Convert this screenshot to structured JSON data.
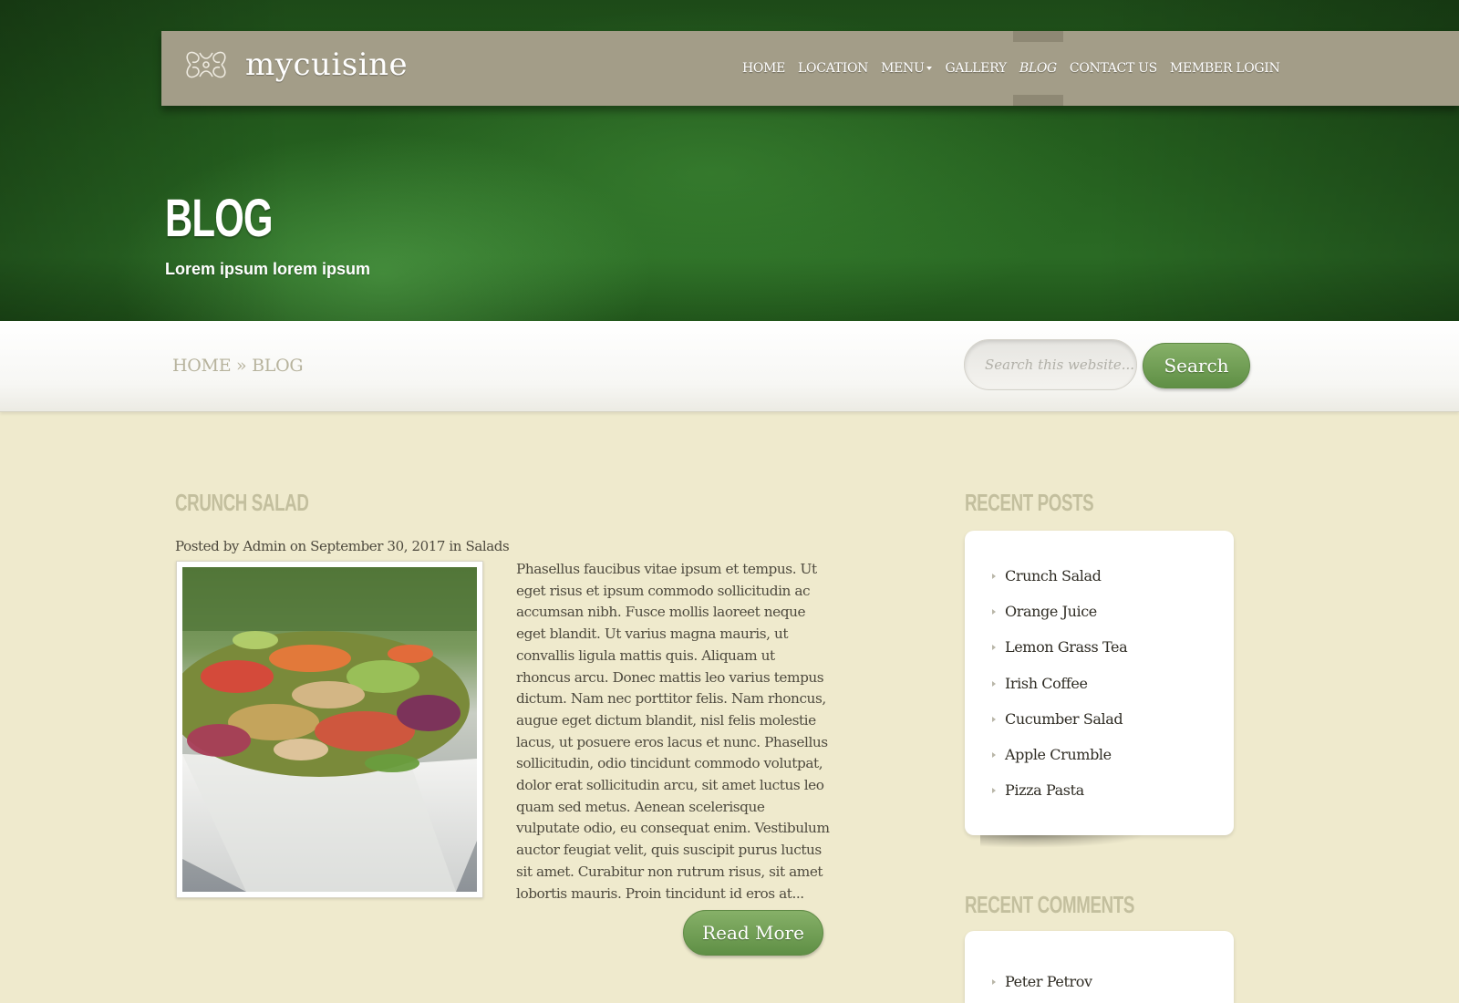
{
  "brand": {
    "name": "mycuisine",
    "logo_icon": "ornament-logo-icon"
  },
  "nav": {
    "items": [
      {
        "label": "HOME"
      },
      {
        "label": "LOCATION"
      },
      {
        "label": "MENU"
      },
      {
        "label": "GALLERY"
      },
      {
        "label": "BLOG"
      },
      {
        "label": "CONTACT US"
      },
      {
        "label": "MEMBER LOGIN"
      }
    ],
    "active": "BLOG",
    "dropdown_icon": "caret-down-icon"
  },
  "hero": {
    "title": "BLOG",
    "subtitle": "Lorem ipsum lorem ipsum"
  },
  "breadcrumb": {
    "home": "HOME",
    "separator": "»",
    "current": "BLOG"
  },
  "search": {
    "placeholder": "Search this website...",
    "button_label": "Search"
  },
  "post": {
    "title": "CRUNCH SALAD",
    "meta": {
      "prefix": "Posted by",
      "author": "Admin",
      "on": "on",
      "date": "September 30, 2017",
      "in": "in",
      "category": "Salads"
    },
    "excerpt": "Phasellus faucibus vitae ipsum et tempus. Ut eget risus et ipsum commodo sollicitudin ac accumsan nibh. Fusce mollis laoreet neque eget blandit. Ut varius magna mauris, ut convallis ligula mattis quis. Aliquam ut rhoncus arcu. Donec mattis leo varius tempus dictum. Nam nec porttitor felis. Nam rhoncus, augue eget dictum blandit, nisl felis molestie lacus, ut posuere eros lacus et nunc. Phasellus sollicitudin, odio tincidunt commodo volutpat, dolor erat sollicitudin arcu, sit amet luctus leo quam sed metus. Aenean scelerisque vulputate odio, eu consequat enim. Vestibulum auctor feugiat velit, quis suscipit purus luctus sit amet. Curabitur non rutrum risus, sit amet lobortis mauris. Proin tincidunt id eros at...",
    "read_more": "Read More",
    "image_icon": "salad-bowl-photo"
  },
  "sidebar": {
    "recent_posts": {
      "title": "RECENT POSTS",
      "items": [
        "Crunch Salad",
        "Orange Juice",
        "Lemon Grass Tea",
        "Irish Coffee",
        "Cucumber Salad",
        "Apple Crumble",
        "Pizza Pasta"
      ]
    },
    "recent_comments": {
      "title": "RECENT COMMENTS",
      "items": [
        "Peter Petrov"
      ]
    }
  },
  "colors": {
    "hero_green": "#245e1e",
    "nav_bar": "#a39d88",
    "page_bg": "#efeacd",
    "button_green": "#6f9d52",
    "heading_muted": "#c3bf9e"
  }
}
